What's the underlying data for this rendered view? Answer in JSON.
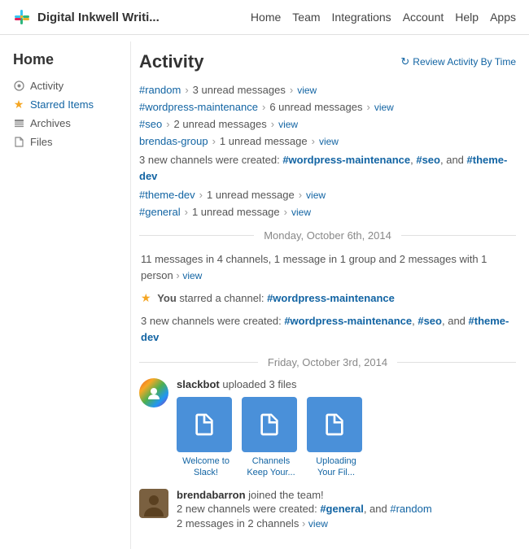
{
  "app": {
    "logo_text": "Digital Inkwell Writi...",
    "logo_alt": "Digital Inkwell Writing"
  },
  "nav": {
    "links": [
      {
        "label": "Home",
        "id": "home"
      },
      {
        "label": "Team",
        "id": "team"
      },
      {
        "label": "Integrations",
        "id": "integrations"
      },
      {
        "label": "Account",
        "id": "account"
      },
      {
        "label": "Help",
        "id": "help"
      },
      {
        "label": "Apps",
        "id": "apps"
      }
    ]
  },
  "sidebar": {
    "title": "Home",
    "items": [
      {
        "label": "Activity",
        "icon": "●",
        "id": "activity"
      },
      {
        "label": "Starred Items",
        "icon": "★",
        "id": "starred"
      },
      {
        "label": "Archives",
        "icon": "≡",
        "id": "archives"
      },
      {
        "label": "Files",
        "icon": "📄",
        "id": "files"
      }
    ]
  },
  "content": {
    "title": "Activity",
    "review_link": "Review Activity By Time",
    "activity": [
      {
        "channel": "#random",
        "msg_count": "3 unread messages",
        "has_view": true
      },
      {
        "channel": "#wordpress-maintenance",
        "msg_count": "6 unread messages",
        "has_view": true
      },
      {
        "channel": "#seo",
        "msg_count": "2 unread messages",
        "has_view": true
      },
      {
        "channel": "brendas-group",
        "msg_count": "1 unread message",
        "has_view": true
      }
    ],
    "new_channels_intro": "3 new channels were created:",
    "new_channels": [
      "#wordpress-maintenance",
      "#seo",
      "and",
      "#theme-dev"
    ],
    "activity2": [
      {
        "channel": "#theme-dev",
        "msg_count": "1 unread message",
        "has_view": true
      },
      {
        "channel": "#general",
        "msg_count": "1 unread message",
        "has_view": true
      }
    ],
    "dates": [
      {
        "label": "Monday, October 6th, 2014",
        "items": [
          {
            "type": "summary",
            "text": "11 messages in 4 channels, 1 message in 1 group and 2 messages with 1 person",
            "has_view": true
          },
          {
            "type": "starred",
            "text": "You starred a channel:",
            "channel": "#wordpress-maintenance"
          },
          {
            "type": "new_channels",
            "text": "3 new channels were created:",
            "channels": [
              "#wordpress-maintenance",
              "#seo",
              "and",
              "#theme-dev"
            ]
          }
        ]
      },
      {
        "label": "Friday, October 3rd, 2014",
        "items": []
      }
    ],
    "slackbot": {
      "name": "slackbot",
      "action": "uploaded 3 files",
      "files": [
        {
          "name": "Welcome to Slack!"
        },
        {
          "name": "Channels Keep Your..."
        },
        {
          "name": "Uploading Your Fil..."
        }
      ]
    },
    "brendabarron": {
      "name": "brendabarron",
      "action": "joined the team!",
      "new_channels_text": "2 new channels were created:",
      "new_channels": [
        "#general",
        "and",
        "#random"
      ],
      "summary": "2 messages in 2 channels",
      "has_view": true
    }
  }
}
